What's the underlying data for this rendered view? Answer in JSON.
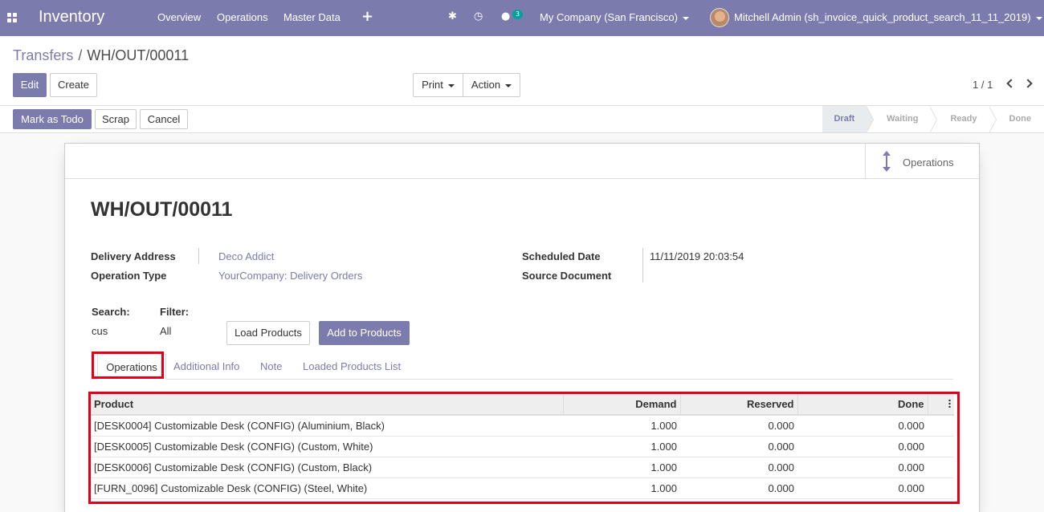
{
  "topbar": {
    "app_name": "Inventory",
    "menu": [
      "Overview",
      "Operations",
      "Master Data"
    ],
    "plus_icon": "plus-icon",
    "chat_badge": "3",
    "company": "My Company (San Francisco)",
    "user": "Mitchell Admin (sh_invoice_quick_product_search_11_11_2019)"
  },
  "breadcrumb": {
    "parent": "Transfers",
    "separator": "/",
    "current": "WH/OUT/00011"
  },
  "control": {
    "edit": "Edit",
    "create": "Create",
    "print": "Print",
    "action": "Action",
    "pager": "1 / 1"
  },
  "statusbar": {
    "mark_todo": "Mark as Todo",
    "scrap": "Scrap",
    "cancel": "Cancel",
    "stages": [
      "Draft",
      "Waiting",
      "Ready",
      "Done"
    ],
    "active_stage": "Draft"
  },
  "form": {
    "smart_button": "Operations",
    "title": "WH/OUT/00011",
    "delivery_address_label": "Delivery Address",
    "delivery_address": "Deco Addict",
    "operation_type_label": "Operation Type",
    "operation_type": "YourCompany: Delivery Orders",
    "scheduled_date_label": "Scheduled Date",
    "scheduled_date": "11/11/2019 20:03:54",
    "source_document_label": "Source Document",
    "search_label": "Search:",
    "search_value": "cus",
    "filter_label": "Filter:",
    "filter_value": "All",
    "load_products": "Load Products",
    "add_to_products": "Add to Products"
  },
  "tabs": [
    "Operations",
    "Additional Info",
    "Note",
    "Loaded Products List"
  ],
  "table": {
    "headers": [
      "Product",
      "Demand",
      "Reserved",
      "Done"
    ],
    "rows": [
      {
        "product": "[DESK0004] Customizable Desk (CONFIG) (Aluminium, Black)",
        "demand": "1.000",
        "reserved": "0.000",
        "done": "0.000"
      },
      {
        "product": "[DESK0005] Customizable Desk (CONFIG) (Custom, White)",
        "demand": "1.000",
        "reserved": "0.000",
        "done": "0.000"
      },
      {
        "product": "[DESK0006] Customizable Desk (CONFIG) (Custom, Black)",
        "demand": "1.000",
        "reserved": "0.000",
        "done": "0.000"
      },
      {
        "product": "[FURN_0096] Customizable Desk (CONFIG) (Steel, White)",
        "demand": "1.000",
        "reserved": "0.000",
        "done": "0.000"
      }
    ]
  },
  "colors": {
    "brand": "#7c7bad",
    "highlight": "#e0001b"
  }
}
